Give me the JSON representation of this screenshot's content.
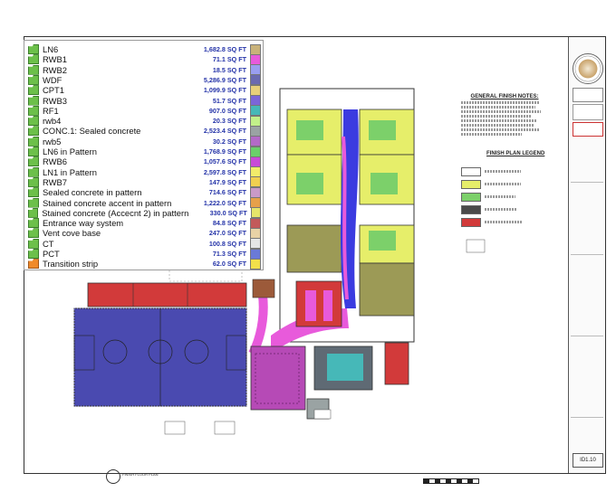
{
  "legend": {
    "items": [
      {
        "name": "LN6",
        "value": "1,682.8 SQ FT",
        "color": "#c9b27a"
      },
      {
        "name": "RWB1",
        "value": "71.1 SQ FT",
        "color": "#e85adb"
      },
      {
        "name": "RWB2",
        "value": "18.5 SQ FT",
        "color": "#9a9ef0"
      },
      {
        "name": "WDF",
        "value": "5,286.9 SQ FT",
        "color": "#6a6ab0"
      },
      {
        "name": "CPT1",
        "value": "1,099.9 SQ FT",
        "color": "#e7d07a"
      },
      {
        "name": "RWB3",
        "value": "51.7 SQ FT",
        "color": "#7b66d8"
      },
      {
        "name": "RF1",
        "value": "907.0 SQ FT",
        "color": "#46b8b8"
      },
      {
        "name": "rwb4",
        "value": "20.3 SQ FT",
        "color": "#c2f08a"
      },
      {
        "name": "CONC.1: Sealed concrete",
        "value": "2,523.4 SQ FT",
        "color": "#9aa3a3"
      },
      {
        "name": "rwb5",
        "value": "30.2 SQ FT",
        "color": "#b36ac7"
      },
      {
        "name": "LN6 in Pattern",
        "value": "1,768.9 SQ FT",
        "color": "#6ad06a"
      },
      {
        "name": "RWB6",
        "value": "1,057.6 SQ FT",
        "color": "#c84ad8"
      },
      {
        "name": "LN1 in Pattern",
        "value": "2,597.8 SQ FT",
        "color": "#f2ec6a"
      },
      {
        "name": "RWB7",
        "value": "147.9 SQ FT",
        "color": "#f0d050"
      },
      {
        "name": "Sealed concrete in pattern",
        "value": "714.6 SQ FT",
        "color": "#c99ac8"
      },
      {
        "name": "Stained concrete accent in pattern",
        "value": "1,222.0 SQ FT",
        "color": "#e6a04a"
      },
      {
        "name": "Stained concrete (Accecnt 2) in pattern",
        "value": "330.0 SQ FT",
        "color": "#e6e66a"
      },
      {
        "name": "Entrance way system",
        "value": "84.8 SQ FT",
        "color": "#c25a5a"
      },
      {
        "name": "Vent cove base",
        "value": "247.0 SQ FT",
        "color": "#e8d2a6"
      },
      {
        "name": "CT",
        "value": "100.8 SQ FT",
        "color": "#e6e6e6"
      },
      {
        "name": "PCT",
        "value": "71.3 SQ FT",
        "color": "#6a7ad8"
      },
      {
        "name": "Transition strip",
        "value": "62.0 SQ FT",
        "color": "#f2e04a"
      }
    ]
  },
  "drawing": {
    "notes_title": "GENERAL FINISH NOTES:",
    "finish_legend_title": "FINISH PLAN LEGEND",
    "floor_plan_label": "FINISH FLOOR PLAN",
    "sheet_number": "ID1.10"
  }
}
